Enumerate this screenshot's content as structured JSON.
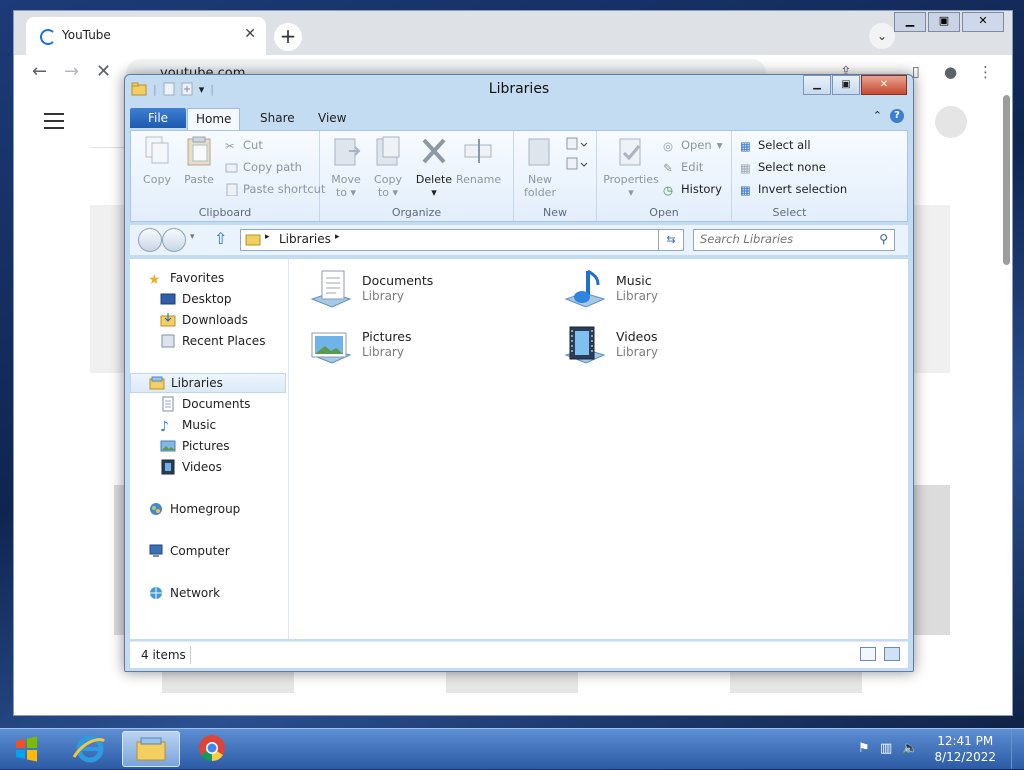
{
  "chrome": {
    "tab_title": "YouTube",
    "url": "youtube.com"
  },
  "explorer": {
    "window_title": "Libraries",
    "ribbon_tabs": [
      "File",
      "Home",
      "Share",
      "View"
    ],
    "ribbon": {
      "clipboard": {
        "label": "Clipboard",
        "copy": "Copy",
        "paste": "Paste",
        "cut": "Cut",
        "copy_path": "Copy path",
        "paste_shortcut": "Paste shortcut"
      },
      "organize": {
        "label": "Organize",
        "move_to_1": "Move",
        "move_to_2": "to",
        "copy_to_1": "Copy",
        "copy_to_2": "to",
        "delete": "Delete",
        "rename": "Rename"
      },
      "new": {
        "label": "New",
        "new_folder_1": "New",
        "new_folder_2": "folder"
      },
      "open": {
        "label": "Open",
        "properties": "Properties",
        "open": "Open",
        "edit": "Edit",
        "history": "History"
      },
      "select": {
        "label": "Select",
        "select_all": "Select all",
        "select_none": "Select none",
        "invert_selection": "Invert selection"
      }
    },
    "address": {
      "crumb": "Libraries",
      "search_placeholder": "Search Libraries"
    },
    "nav": {
      "favorites": "Favorites",
      "desktop": "Desktop",
      "downloads": "Downloads",
      "recent_places": "Recent Places",
      "libraries": "Libraries",
      "documents": "Documents",
      "music": "Music",
      "pictures": "Pictures",
      "videos": "Videos",
      "homegroup": "Homegroup",
      "computer": "Computer",
      "network": "Network"
    },
    "libraries": [
      {
        "name": "Documents",
        "type": "Library"
      },
      {
        "name": "Music",
        "type": "Library"
      },
      {
        "name": "Pictures",
        "type": "Library"
      },
      {
        "name": "Videos",
        "type": "Library"
      }
    ],
    "status": "4 items"
  },
  "taskbar": {
    "time": "12:41 PM",
    "date": "8/12/2022"
  }
}
